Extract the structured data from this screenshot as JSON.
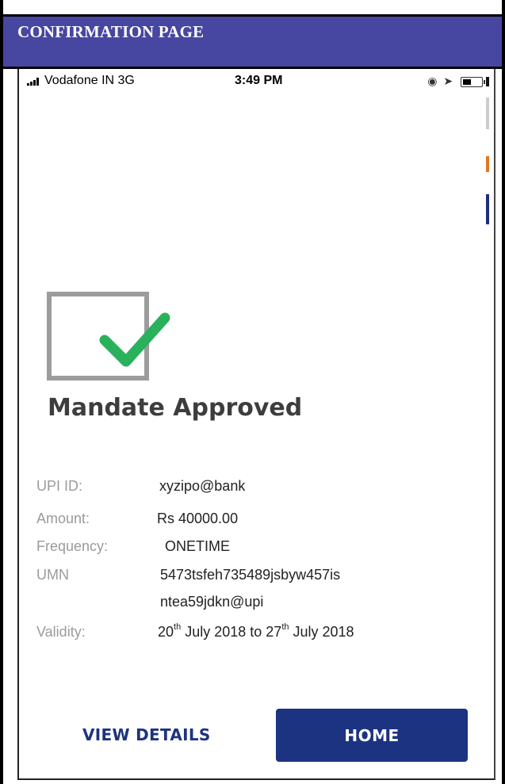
{
  "header": {
    "title": "CONFIRMATION PAGE"
  },
  "statusbar": {
    "carrier": "Vodafone IN  3G",
    "time": "3:49 PM"
  },
  "status": {
    "title": "Mandate Approved"
  },
  "details": {
    "upi_label": "UPI ID:",
    "upi_value": "xyzipo@bank",
    "amount_label": "Amount:",
    "amount_value": "Rs 40000.00",
    "frequency_label": "Frequency:",
    "frequency_value": "ONETIME",
    "umn_label": "UMN",
    "umn_value_line1": "5473tsfeh735489jsbyw457is",
    "umn_value_line2": "ntea59jdkn@upi",
    "validity_label": "Validity:",
    "validity_day1": "20",
    "validity_sup1": "th",
    "validity_mid": " July 2018 to ",
    "validity_day2": "27",
    "validity_sup2": "th",
    "validity_end": " July 2018"
  },
  "buttons": {
    "view_details": "VIEW DETAILS",
    "home": "HOME"
  },
  "colors": {
    "header_bg": "#4747a1",
    "button_bg": "#1c3382",
    "check_green": "#2ab15c"
  }
}
